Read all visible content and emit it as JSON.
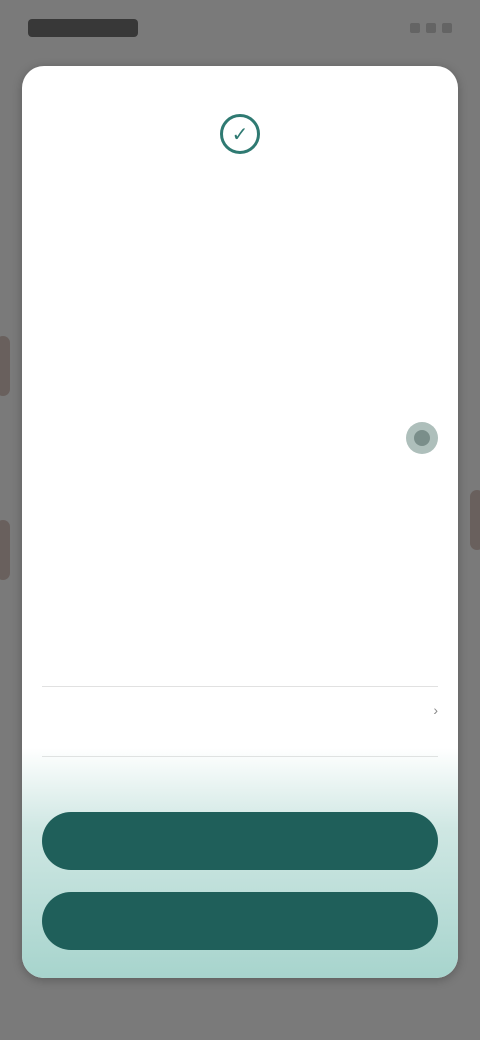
{
  "status_bar": {
    "time": "",
    "icons": [
      "signal-icon",
      "wifi-icon",
      "battery-icon"
    ]
  },
  "modal": {
    "icon": "check-circle-icon",
    "intro_text": "",
    "section_heading": "",
    "toggle_label": "",
    "toggle_state": "off",
    "description": "",
    "link_text": "",
    "row1_label": "",
    "row2_label": "",
    "buttons": {
      "accept": "",
      "save": ""
    }
  },
  "colors": {
    "accent": "#1f5f5a",
    "accent_light": "#a7d4cd",
    "overlay": "#7a7a7a"
  }
}
